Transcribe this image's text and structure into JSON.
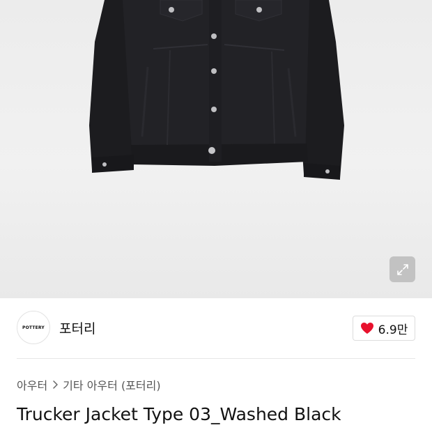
{
  "product": {
    "title": "Trucker Jacket Type 03_Washed Black",
    "image_alt": "black trucker jacket"
  },
  "brand": {
    "logo_text": "POTTERY",
    "name": "포터리"
  },
  "like": {
    "count": "6.9만",
    "icon": "heart-icon",
    "color": "#e8112d"
  },
  "breadcrumb": {
    "items": [
      "아우터",
      "기타 아우터 (포터리)"
    ],
    "separator_icon": "chevron-right-icon"
  },
  "image_controls": {
    "expand_icon": "expand-icon"
  }
}
